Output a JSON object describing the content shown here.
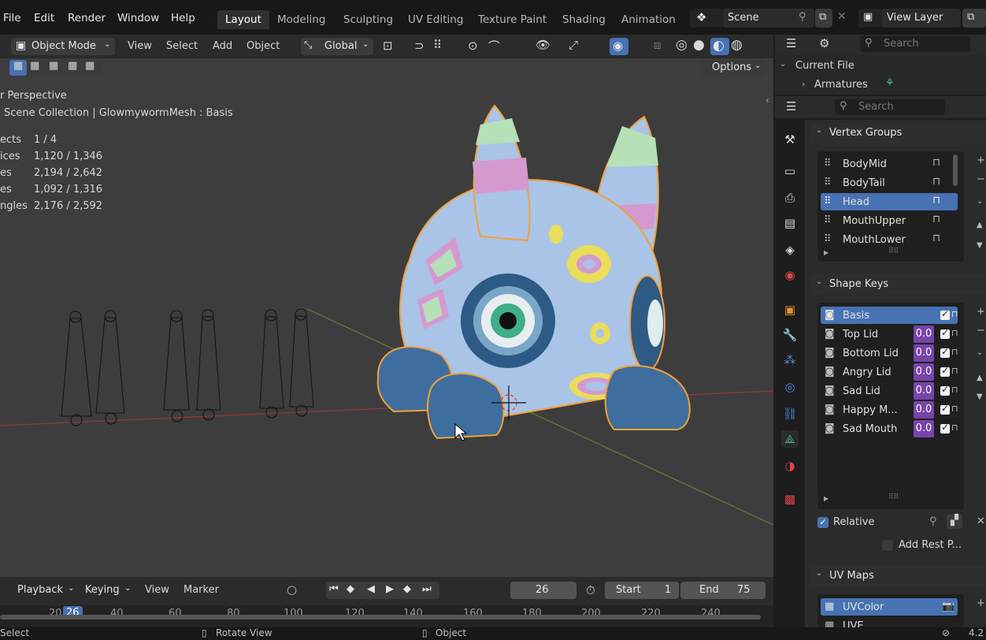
{
  "menus": [
    "File",
    "Edit",
    "Render",
    "Window",
    "Help"
  ],
  "workspaces": [
    "Layout",
    "Modeling",
    "Sculpting",
    "UV Editing",
    "Texture Paint",
    "Shading",
    "Animation"
  ],
  "active_workspace": "Layout",
  "scene": "Scene",
  "view_layer": "View Layer",
  "viewport_header": {
    "mode": "Object Mode",
    "menus": [
      "View",
      "Select",
      "Add",
      "Object"
    ],
    "orientation": "Global"
  },
  "options_label": "Options",
  "overlay": {
    "perspective": "r Perspective",
    "collection": "Scene Collection | GlowmywormMesh : Basis",
    "stats": [
      {
        "label": "ects",
        "value": "1 / 4"
      },
      {
        "label": "ices",
        "value": "1,120 / 1,346"
      },
      {
        "label": "es",
        "value": "2,194 / 2,642"
      },
      {
        "label": "es",
        "value": "1,092 / 1,316"
      },
      {
        "label": "ngles",
        "value": "2,176 / 2,592"
      }
    ]
  },
  "outliner": {
    "search_placeholder": "Search",
    "current_file": "Current File",
    "armatures": "Armatures"
  },
  "properties": {
    "search_placeholder": "Search",
    "vertex_groups_title": "Vertex Groups",
    "vertex_groups": [
      "BodyMid",
      "BodyTail",
      "Head",
      "MouthUpper",
      "MouthLower"
    ],
    "vertex_group_selected": "Head",
    "shape_keys_title": "Shape Keys",
    "shape_keys": [
      {
        "name": "Basis",
        "value": ""
      },
      {
        "name": "Top Lid",
        "value": "0.0"
      },
      {
        "name": "Bottom Lid",
        "value": "0.0"
      },
      {
        "name": "Angry Lid",
        "value": "0.0"
      },
      {
        "name": "Sad Lid",
        "value": "0.0"
      },
      {
        "name": "Happy M...",
        "value": "0.0"
      },
      {
        "name": "Sad Mouth",
        "value": "0.0"
      }
    ],
    "relative_label": "Relative",
    "add_rest_label": "Add Rest P...",
    "uv_maps_title": "UV Maps",
    "uv_maps": [
      "UVColor",
      "UVE"
    ]
  },
  "timeline": {
    "menus": [
      "Playback",
      "Keying",
      "View",
      "Marker"
    ],
    "current_frame": "26",
    "start_label": "Start",
    "start_value": "1",
    "end_label": "End",
    "end_value": "75",
    "ruler": [
      "20",
      "26",
      "40",
      "60",
      "80",
      "100",
      "120",
      "140",
      "160",
      "180",
      "200",
      "220",
      "240"
    ]
  },
  "statusbar": {
    "left": "Select",
    "middle": "Rotate View",
    "right": "Object",
    "version": "4.2"
  },
  "colors": {
    "selection": "#4772b3",
    "value_field": "#7744aa",
    "outline": "#f2a03a",
    "body": "#a9c4e6",
    "foot": "#3e6e9e"
  }
}
